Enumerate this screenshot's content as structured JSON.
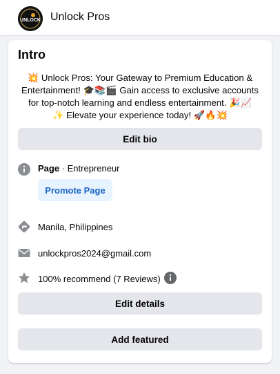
{
  "header": {
    "avatar_text": "UNLOCK",
    "title": "Unlock Pros"
  },
  "intro": {
    "title": "Intro",
    "bio_lines": [
      "💥 Unlock Pros: Your Gateway to Premium Education &",
      "Entertainment! 🎓📚🎬 Gain access to exclusive accounts",
      "for top-notch learning and endless entertainment. 🎉📈",
      "✨ Elevate your experience today! 🚀🔥💥"
    ],
    "edit_bio_label": "Edit bio",
    "page_label": "Page",
    "page_category": " · Entrepreneur",
    "promote_label": "Promote Page",
    "location": "Manila, Philippines",
    "email": "unlockpros2024@gmail.com",
    "recommend": "100% recommend (7 Reviews)",
    "edit_details_label": "Edit details",
    "add_featured_label": "Add featured"
  },
  "colors": {
    "background": "#f0f2f5",
    "button_gray": "#e4e6eb",
    "promote_bg": "#e7f3ff",
    "promote_text": "#1a66c2",
    "icon_gray": "#8a8d91"
  },
  "icons": [
    "info-icon",
    "directions-icon",
    "mail-icon",
    "star-icon",
    "info-icon"
  ]
}
